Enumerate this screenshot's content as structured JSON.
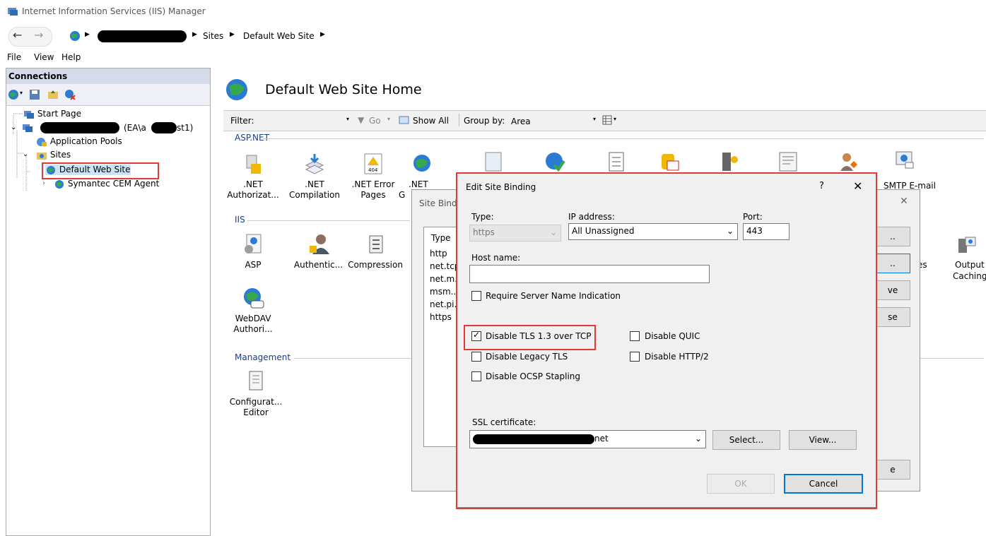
{
  "window": {
    "title": "Internet Information Services (IIS) Manager"
  },
  "nav": {
    "back_icon": "back-arrow-icon",
    "forward_icon": "forward-arrow-icon",
    "crumbs": [
      "Sites",
      "Default Web Site"
    ],
    "sep": "▶"
  },
  "menu": [
    "File",
    "View",
    "Help"
  ],
  "connections": {
    "title": "Connections",
    "tree": {
      "start_page": "Start Page",
      "server_suffix": "(EA\\a",
      "server_suffix2": "st1)",
      "app_pools": "Application Pools",
      "sites": "Sites",
      "default_site": "Default Web Site",
      "cem_agent": "Symantec CEM Agent"
    }
  },
  "main": {
    "title": "Default Web Site Home",
    "filter": {
      "label": "Filter:",
      "go": "Go",
      "show_all": "Show All",
      "group_by_label": "Group by:",
      "group_by_value": "Area"
    },
    "groups": {
      "aspnet": "ASP.NET",
      "iis": "IIS",
      "management": "Management"
    },
    "aspnet_features": [
      {
        "l1": ".NET",
        "l2": "Authorizat..."
      },
      {
        "l1": ".NET",
        "l2": "Compilation"
      },
      {
        "l1": ".NET Error",
        "l2": "Pages"
      },
      {
        "l1": ".NET",
        "l2": "G"
      }
    ],
    "iis_features": [
      {
        "l1": "ASP",
        "l2": ""
      },
      {
        "l1": "Authentic...",
        "l2": ""
      },
      {
        "l1": "Compression",
        "l2": ""
      }
    ],
    "webdav": {
      "l1": "WebDAV",
      "l2": "Authori..."
    },
    "config_editor": {
      "l1": "Configurat...",
      "l2": "Editor"
    },
    "right_items": {
      "smtp": "SMTP E-mail",
      "output": "Output",
      "output2": "Caching",
      "es": "es"
    }
  },
  "site_bindings": {
    "title": "Site Bind",
    "type_header": "Type",
    "types": [
      "http",
      "net.tcp",
      "net.m..",
      "msm..",
      "net.pi..",
      "https"
    ],
    "btn_stubs": [
      "..",
      "..",
      "ve",
      "se",
      "e"
    ]
  },
  "edit_binding": {
    "title": "Edit Site Binding",
    "help": "?",
    "close": "✕",
    "type_label": "Type:",
    "type_value": "https",
    "ip_label": "IP address:",
    "ip_value": "All Unassigned",
    "port_label": "Port:",
    "port_value": "443",
    "host_label": "Host name:",
    "host_value": "",
    "sni_label": "Require Server Name Indication",
    "tls13_label": "Disable TLS 1.3 over TCP",
    "quic_label": "Disable QUIC",
    "legacy_tls_label": "Disable Legacy TLS",
    "http2_label": "Disable HTTP/2",
    "ocsp_label": "Disable OCSP Stapling",
    "ssl_label": "SSL certificate:",
    "ssl_value_suffix": "net",
    "select_btn": "Select...",
    "view_btn": "View...",
    "ok_btn": "OK",
    "cancel_btn": "Cancel",
    "checks": {
      "sni": false,
      "tls13": true,
      "quic": false,
      "legacy": false,
      "http2": false,
      "ocsp": false
    }
  },
  "colors": {
    "highlight_red": "#e53935",
    "accent_blue": "#0078d7"
  }
}
